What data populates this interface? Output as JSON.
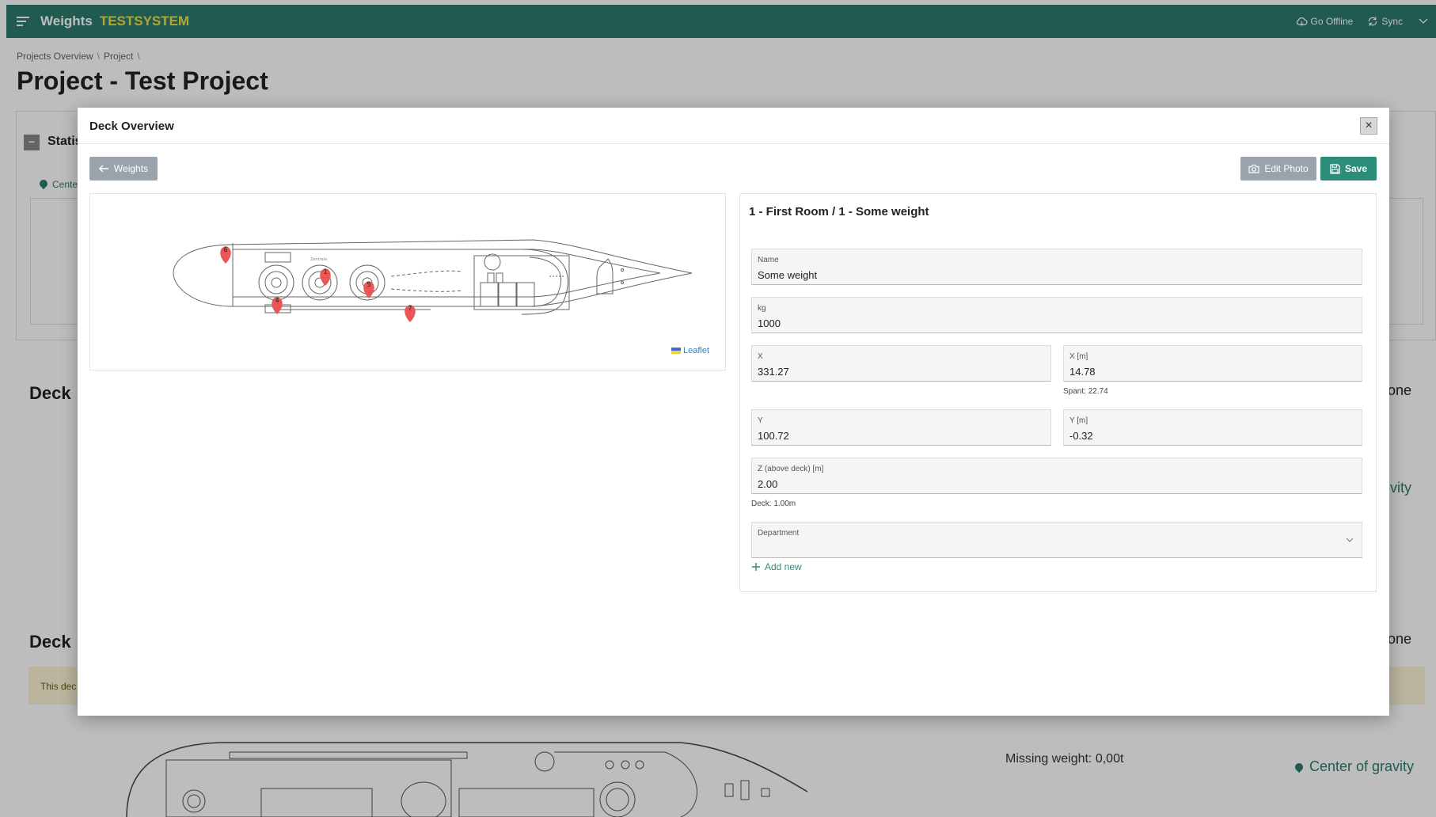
{
  "app": {
    "title": "Weights",
    "subtitle": "TESTSYSTEM"
  },
  "topbar": {
    "go_offline": "Go Offline",
    "sync": "Sync"
  },
  "breadcrumb": [
    "Projects Overview",
    "Project"
  ],
  "page_title": "Project - Test Project",
  "background": {
    "statistics_label": "Statis",
    "center_link": "Cente",
    "deck_heading": "Deck",
    "right_partial_1": "one",
    "right_partial_2": "vity",
    "right_partial_3": "one",
    "warning_text": "This dec",
    "missing_weight": "Missing weight: 0,00t",
    "center_of_gravity": "Center of gravity"
  },
  "modal": {
    "title": "Deck Overview",
    "back_label": "Weights",
    "edit_photo_label": "Edit Photo",
    "save_label": "Save",
    "leaflet_label": "Leaflet",
    "form_title": "1 - First Room / 1 - Some weight",
    "fields": {
      "name": {
        "label": "Name",
        "value": "Some weight"
      },
      "kg": {
        "label": "kg",
        "value": "1000"
      },
      "x": {
        "label": "X",
        "value": "331.27"
      },
      "x_m": {
        "label": "X [m]",
        "value": "14.78"
      },
      "spant": "Spant: 22.74",
      "y": {
        "label": "Y",
        "value": "100.72"
      },
      "y_m": {
        "label": "Y [m]",
        "value": "-0.32"
      },
      "z": {
        "label": "Z (above deck) [m]",
        "value": "2.00"
      },
      "deck": "Deck: 1.00m",
      "department": {
        "label": "Department",
        "value": ""
      }
    },
    "add_new_label": "Add new",
    "markers": [
      "6",
      "1",
      "5",
      "4",
      "7"
    ],
    "map_labels": [
      "Zentrale"
    ]
  },
  "colors": {
    "topbar": "#2d7a6e",
    "brand_accent": "#f0e046",
    "save_button": "#2d8c7a",
    "secondary_button": "#9aa3ab",
    "marker": "#e85656"
  }
}
